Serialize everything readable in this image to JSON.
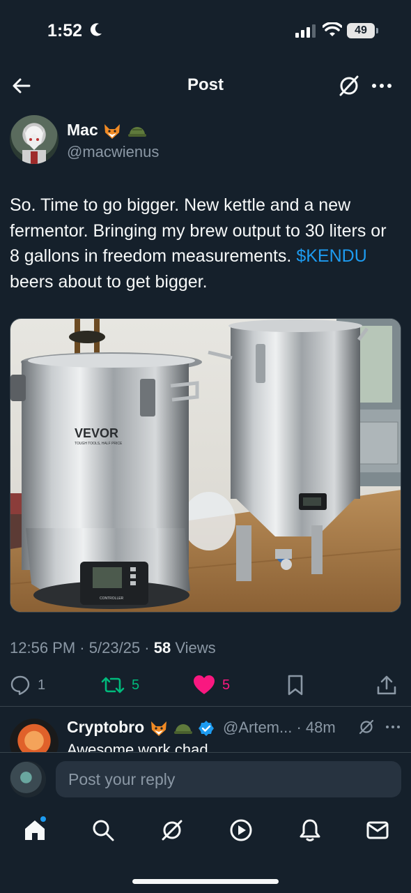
{
  "status_bar": {
    "time": "1:52",
    "battery": "49"
  },
  "header": {
    "title": "Post"
  },
  "author": {
    "name": "Mac",
    "handle": "@macwienus"
  },
  "post": {
    "text_before": "So. Time to go bigger. New kettle and a new fermentor. Bringing my brew output to 30 liters or 8 gallons in freedom measurements. ",
    "cashtag": "$KENDU",
    "text_after": " beers about to get bigger."
  },
  "media": {
    "brand_text": "VEVOR",
    "brand_sub": "TOUGH TOOLS, HALF PRICE",
    "controller_label": "CONTROLLER"
  },
  "meta": {
    "time": "12:56 PM",
    "date": "5/23/25",
    "views_count": "58",
    "views_label": " Views"
  },
  "actions": {
    "replies": "1",
    "reposts": "5",
    "likes": "5"
  },
  "reply": {
    "name": "Cryptobro",
    "handle": "@Artem...",
    "time": "48m",
    "text": "Awesome work chad"
  },
  "compose": {
    "placeholder": "Post your reply"
  },
  "colors": {
    "background": "#15202b",
    "accent": "#1d9bf0",
    "like": "#f91880",
    "repost": "#00ba7c",
    "muted": "#8b98a5"
  }
}
